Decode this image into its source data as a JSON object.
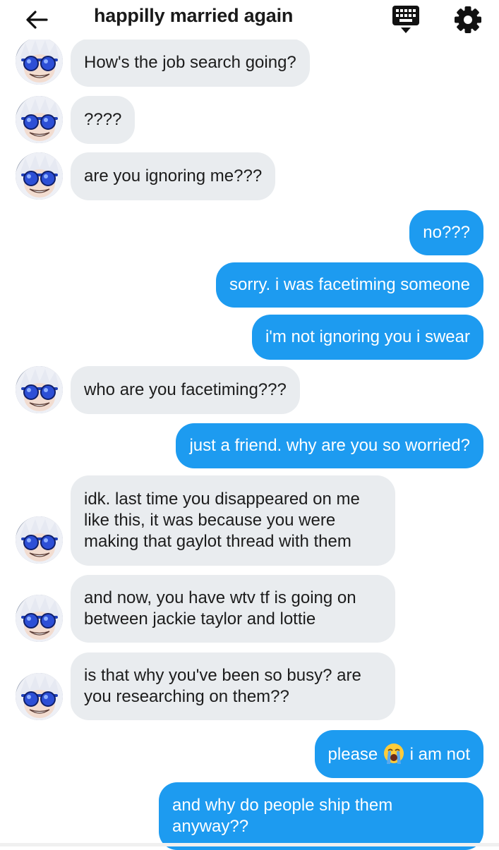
{
  "header": {
    "title": "happilly married again",
    "back_icon": "arrow-left-icon",
    "keyboard_icon": "keyboard-icon",
    "settings_icon": "gear-icon"
  },
  "colors": {
    "outgoing_bubble": "#1d9bf0",
    "incoming_bubble": "#e9ecef"
  },
  "messages": [
    {
      "dir": "in",
      "text": "How's the job search going?"
    },
    {
      "dir": "in",
      "text": "????"
    },
    {
      "dir": "in",
      "text": "are you ignoring me???"
    },
    {
      "dir": "out",
      "text": "no???"
    },
    {
      "dir": "out",
      "text": "sorry. i was facetiming someone"
    },
    {
      "dir": "out",
      "text": "i'm not ignoring you i swear"
    },
    {
      "dir": "in",
      "text": "who are you facetiming???"
    },
    {
      "dir": "out",
      "text": "just a friend. why are you so worried?"
    },
    {
      "dir": "in",
      "text": "idk. last time you disappeared on me like this, it was because you were making that gaylot thread with them"
    },
    {
      "dir": "in",
      "text": "and now, you have wtv tf is going on between jackie taylor and lottie"
    },
    {
      "dir": "in",
      "text": "is that why you've been so busy? are you researching on them??"
    },
    {
      "dir": "out",
      "text_before": "please",
      "emoji": "loudly-crying-face-emoji",
      "text_after": "i am not"
    },
    {
      "dir": "out",
      "text": "and why do people ship them anyway??"
    }
  ]
}
